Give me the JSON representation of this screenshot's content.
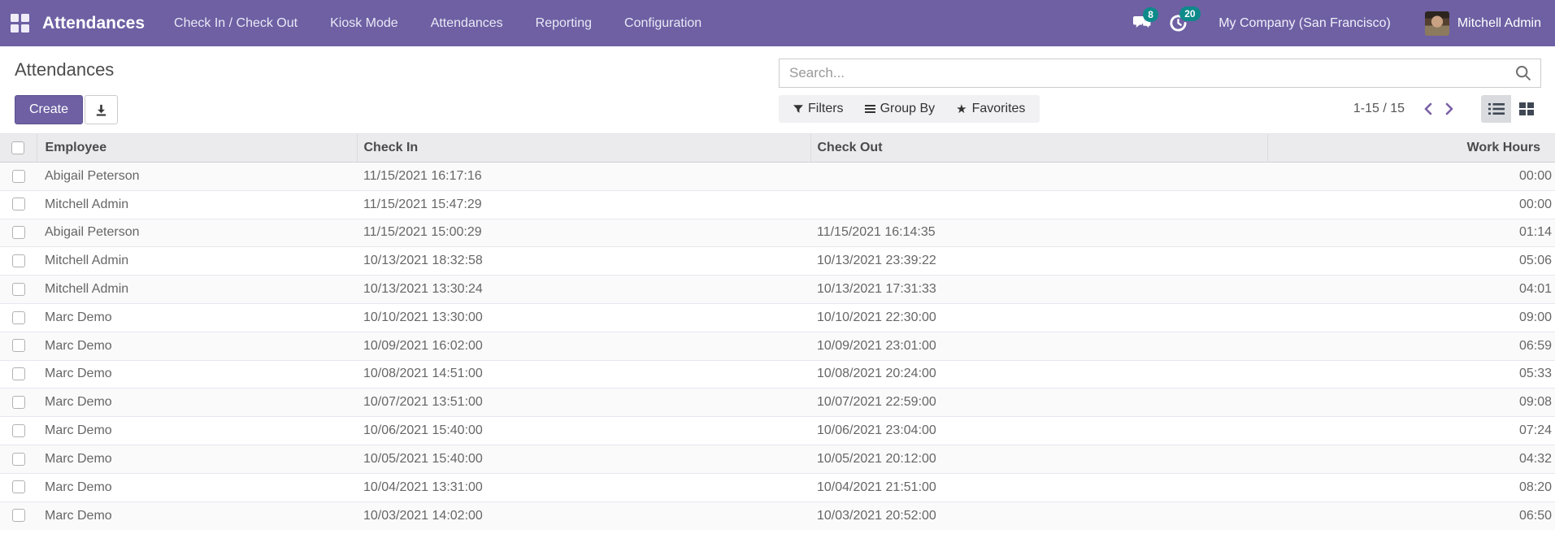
{
  "navbar": {
    "brand": "Attendances",
    "menu_items": [
      {
        "label": "Check In / Check Out"
      },
      {
        "label": "Kiosk Mode"
      },
      {
        "label": "Attendances"
      },
      {
        "label": "Reporting"
      },
      {
        "label": "Configuration"
      }
    ],
    "messages_count": "8",
    "activities_count": "20",
    "company": "My Company (San Francisco)",
    "user": "Mitchell Admin"
  },
  "control_panel": {
    "breadcrumb": "Attendances",
    "create_label": "Create",
    "search": {
      "placeholder": "Search..."
    },
    "filters_label": "Filters",
    "group_by_label": "Group By",
    "favorites_label": "Favorites",
    "star_glyph": "★",
    "pager": {
      "range": "1-15 / 15"
    }
  },
  "colors": {
    "navbar_bg": "#6e60a3",
    "badge_bg": "#0e8a8a",
    "create_button_bg": "#6e60a3",
    "pager_arrow": "#7a5fa5",
    "table_header_bg": "#ebebee",
    "stripe_row_bg": "#fafafb"
  },
  "table": {
    "columns": [
      "Employee",
      "Check In",
      "Check Out",
      "Work Hours"
    ],
    "rows": [
      {
        "employee": "Abigail Peterson",
        "check_in": "11/15/2021 16:17:16",
        "check_out": "",
        "work_hours": "00:00"
      },
      {
        "employee": "Mitchell Admin",
        "check_in": "11/15/2021 15:47:29",
        "check_out": "",
        "work_hours": "00:00"
      },
      {
        "employee": "Abigail Peterson",
        "check_in": "11/15/2021 15:00:29",
        "check_out": "11/15/2021 16:14:35",
        "work_hours": "01:14"
      },
      {
        "employee": "Mitchell Admin",
        "check_in": "10/13/2021 18:32:58",
        "check_out": "10/13/2021 23:39:22",
        "work_hours": "05:06"
      },
      {
        "employee": "Mitchell Admin",
        "check_in": "10/13/2021 13:30:24",
        "check_out": "10/13/2021 17:31:33",
        "work_hours": "04:01"
      },
      {
        "employee": "Marc Demo",
        "check_in": "10/10/2021 13:30:00",
        "check_out": "10/10/2021 22:30:00",
        "work_hours": "09:00"
      },
      {
        "employee": "Marc Demo",
        "check_in": "10/09/2021 16:02:00",
        "check_out": "10/09/2021 23:01:00",
        "work_hours": "06:59"
      },
      {
        "employee": "Marc Demo",
        "check_in": "10/08/2021 14:51:00",
        "check_out": "10/08/2021 20:24:00",
        "work_hours": "05:33"
      },
      {
        "employee": "Marc Demo",
        "check_in": "10/07/2021 13:51:00",
        "check_out": "10/07/2021 22:59:00",
        "work_hours": "09:08"
      },
      {
        "employee": "Marc Demo",
        "check_in": "10/06/2021 15:40:00",
        "check_out": "10/06/2021 23:04:00",
        "work_hours": "07:24"
      },
      {
        "employee": "Marc Demo",
        "check_in": "10/05/2021 15:40:00",
        "check_out": "10/05/2021 20:12:00",
        "work_hours": "04:32"
      },
      {
        "employee": "Marc Demo",
        "check_in": "10/04/2021 13:31:00",
        "check_out": "10/04/2021 21:51:00",
        "work_hours": "08:20"
      },
      {
        "employee": "Marc Demo",
        "check_in": "10/03/2021 14:02:00",
        "check_out": "10/03/2021 20:52:00",
        "work_hours": "06:50"
      }
    ]
  }
}
